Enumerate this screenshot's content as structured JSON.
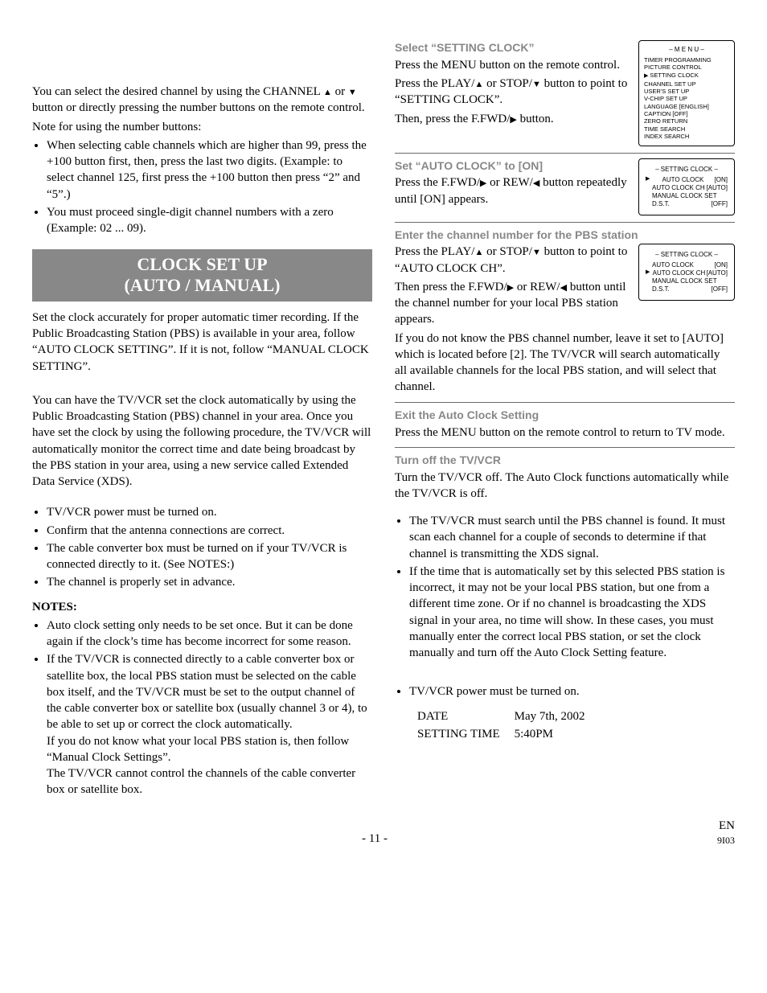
{
  "left": {
    "intro_p1": "You can select the desired channel by using the CHANNEL ",
    "intro_p1b": " or ",
    "intro_p1c": " button or directly pressing the number buttons on the remote control.",
    "intro_p2": "Note for using the number buttons:",
    "intro_bullets": [
      "When selecting cable channels which are higher than 99, press the +100 button first, then, press the last two digits. (Example: to select channel 125, first press the +100 button then press “2” and “5”.)",
      "You must proceed single-digit channel numbers with a zero (Example: 02 ...  09)."
    ],
    "banner_line1": "CLOCK SET UP",
    "banner_line2": "(AUTO / MANUAL)",
    "after_banner": "Set the clock accurately for proper automatic timer recording. If the Public Broadcasting Station (PBS) is available in your area, follow “AUTO CLOCK SETTING”. If it is not, follow “MANUAL CLOCK SETTING”.",
    "auto_para": "You can have the TV/VCR set the clock automatically by using the Public Broadcasting Station (PBS) channel in your area. Once you have set the clock by using the following procedure, the TV/VCR will automatically monitor the correct time and date being broadcast by the PBS station in your area, using a new service called Extended Data Service (XDS).",
    "pre_bullets": [
      "TV/VCR power must be turned on.",
      "Confirm that the antenna connections are correct.",
      "The cable converter box must be turned on if your TV/VCR is connected directly to it. (See NOTES:)",
      "The channel is properly set in advance."
    ],
    "notes_heading": "NOTES:",
    "notes_bullets_1": "Auto clock setting only needs to be set once. But it can be done again if the clock’s time has become incorrect for some reason.",
    "notes_bullets_2": "If the TV/VCR is connected directly to a cable converter box or satellite box, the local PBS station must be selected on the cable box itself, and the TV/VCR must be set to the output channel of the cable converter box or satellite box (usually channel 3 or 4), to be able to set up or correct the clock automatically.",
    "notes_extra_1": "If you do not know what your local PBS station is, then follow “Manual Clock Settings”.",
    "notes_extra_2": "The TV/VCR cannot control the channels of the cable converter box or satellite box."
  },
  "right": {
    "step1_h": "Select “SETTING CLOCK”",
    "step1_p1": "Press the MENU button on the remote control.",
    "step1_p2a": "Press the PLAY/",
    "step1_p2b": " or STOP/",
    "step1_p2c": " button to point to “SETTING CLOCK”.",
    "step1_p3a": "Then, press the F.FWD/",
    "step1_p3b": " button.",
    "osd1_title": "– M E N U –",
    "osd1_items": [
      "TIMER PROGRAMMING",
      "PICTURE CONTROL",
      "SETTING CLOCK",
      "CHANNEL SET UP",
      "USER'S SET UP",
      "V-CHIP SET UP",
      "LANGUAGE  [ENGLISH]",
      "CAPTION  [OFF]",
      "ZERO RETURN",
      "TIME SEARCH",
      "INDEX SEARCH"
    ],
    "step2_h": "Set “AUTO CLOCK” to [ON]",
    "step2_p_a": "Press the F.FWD/",
    "step2_p_b": " or REW/",
    "step2_p_c": " button repeatedly until [ON] appears.",
    "osd2_title": "– SETTING CLOCK –",
    "osd2_rows": [
      {
        "l": "AUTO CLOCK",
        "r": "[ON]",
        "ptr": true
      },
      {
        "l": "AUTO CLOCK CH",
        "r": "[AUTO]"
      },
      {
        "l": "MANUAL CLOCK SET",
        "r": ""
      },
      {
        "l": "D.S.T.",
        "r": "[OFF]"
      }
    ],
    "step3_h": "Enter the channel number for the PBS station",
    "step3_p1a": "Press the PLAY/",
    "step3_p1b": " or STOP/",
    "step3_p1c": " button to point to “AUTO CLOCK CH”.",
    "step3_p2a": "Then press the F.FWD/",
    "step3_p2b": " or REW/",
    "step3_p2c": " button until the channel number for your local PBS station appears.",
    "osd3_title": "– SETTING CLOCK –",
    "osd3_rows": [
      {
        "l": "AUTO CLOCK",
        "r": "[ON]"
      },
      {
        "l": "AUTO CLOCK CH",
        "r": "[AUTO]",
        "ptr": true
      },
      {
        "l": "MANUAL CLOCK SET",
        "r": ""
      },
      {
        "l": "D.S.T.",
        "r": "[OFF]"
      }
    ],
    "step3_p3": "If you do not know the PBS channel number, leave it set to [AUTO] which is located before [2]. The TV/VCR will search automatically all available channels for the local PBS station, and will select that channel.",
    "step4_h": "Exit the Auto Clock Setting",
    "step4_p": "Press the MENU button on the remote control to return to TV mode.",
    "step5_h": "Turn off the TV/VCR",
    "step5_p": "Turn the TV/VCR off. The Auto Clock functions automatically while the TV/VCR is off.",
    "after_bullets": [
      "The TV/VCR must search until the PBS channel is found. It must scan each channel for a couple of seconds to determine if that channel is transmitting the XDS signal.",
      "If the time that is automatically set by this selected PBS station is incorrect, it may not be your local PBS station, but one from a different time zone. Or if no channel is broadcasting the XDS signal in your area, no time will show. In these cases, you must manually enter the correct local PBS station, or set the clock manually and turn off the Auto Clock Setting feature."
    ],
    "final_bullet": "TV/VCR power must be turned on.",
    "example_date_l": "DATE",
    "example_date_v": "May 7th, 2002",
    "example_time_l": "SETTING TIME",
    "example_time_v": "5:40PM"
  },
  "footer": {
    "page": "- 11 -",
    "lang": "EN",
    "code": "9I03"
  }
}
